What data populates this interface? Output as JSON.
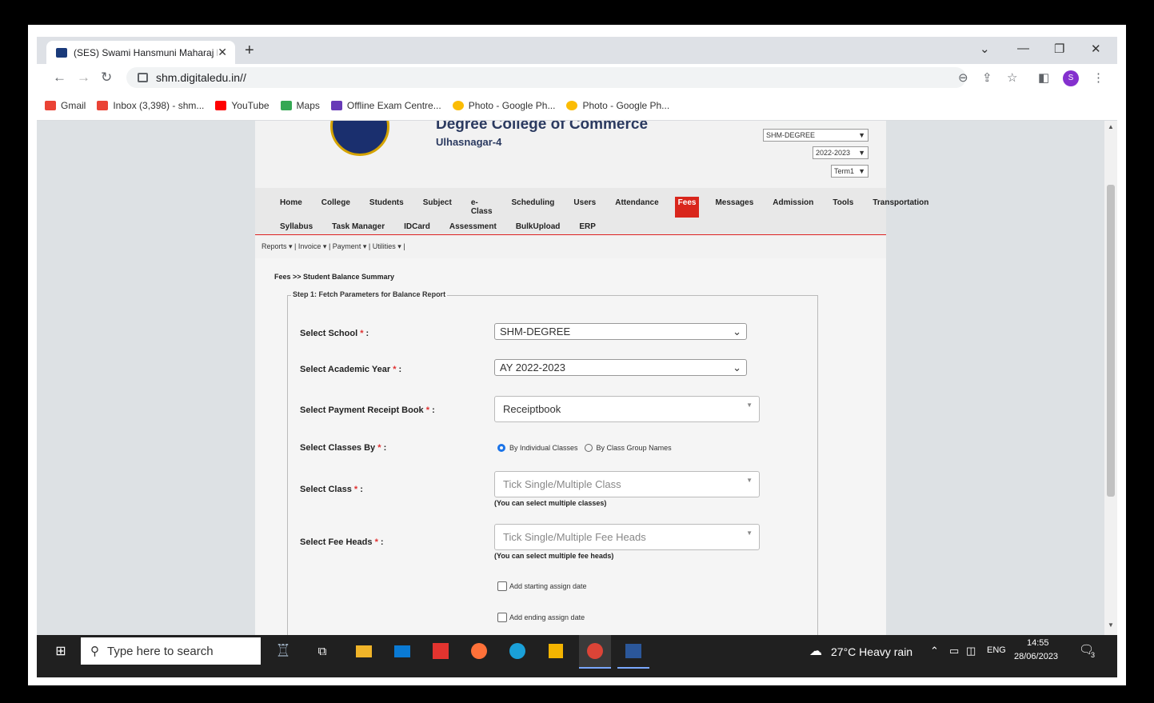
{
  "browser": {
    "tab_title": "(SES) Swami Hansmuni Maharaj Degree College",
    "new_tab": "+",
    "url": "shm.digitaledu.in//"
  },
  "bookmarks": [
    {
      "label": "Gmail",
      "color": "#ea4335"
    },
    {
      "label": "Inbox (3,398) - shm...",
      "color": "#ea4335"
    },
    {
      "label": "YouTube",
      "color": "#ff0000"
    },
    {
      "label": "Maps",
      "color": "#34a853"
    },
    {
      "label": "Offline Exam Centre...",
      "color": "#673ab7"
    },
    {
      "label": "Photo - Google Ph...",
      "color": "#fbbc04"
    },
    {
      "label": "Photo - Google Ph...",
      "color": "#fbbc04"
    }
  ],
  "header": {
    "college_name": "Degree College of Commerce",
    "college_city": "Ulhasnagar-4",
    "school_select": "SHM-DEGREE",
    "year_select": "2022-2023",
    "term_select": "Term1"
  },
  "menu": {
    "row1": [
      "Home",
      "College",
      "Students",
      "Subject",
      "e-Class",
      "Scheduling",
      "Users",
      "Attendance",
      "Fees",
      "Messages",
      "Admission",
      "Tools",
      "Transportation"
    ],
    "row2": [
      "Syllabus",
      "Task Manager",
      "IDCard",
      "Assessment",
      "BulkUpload",
      "ERP"
    ],
    "active": "Fees"
  },
  "submenu": [
    "Reports",
    "Invoice",
    "Payment",
    "Utilities"
  ],
  "breadcrumb": "Fees >> Student Balance Summary",
  "form": {
    "legend": "Step 1: Fetch Parameters for Balance Report",
    "school_label": "Select School",
    "school_value": "SHM-DEGREE",
    "year_label": "Select Academic Year",
    "year_value": "AY 2022-2023",
    "receipt_label": "Select Payment Receipt Book",
    "receipt_value": "Receiptbook",
    "classes_by_label": "Select Classes By",
    "radio_individual": "By Individual Classes",
    "radio_group": "By Class Group Names",
    "class_label": "Select Class",
    "class_placeholder": "Tick Single/Multiple Class",
    "class_hint": "(You can select multiple classes)",
    "feeheads_label": "Select Fee Heads",
    "feeheads_placeholder": "Tick Single/Multiple Fee Heads",
    "feeheads_hint": "(You can select multiple fee heads)",
    "start_date_label": "Add starting assign date",
    "end_date_label": "Add ending assign date",
    "required_mark": "*"
  },
  "taskbar": {
    "search_placeholder": "Type here to search",
    "weather": "27°C  Heavy rain",
    "lang": "ENG",
    "time": "14:55",
    "date": "28/06/2023",
    "notifications": "3"
  }
}
